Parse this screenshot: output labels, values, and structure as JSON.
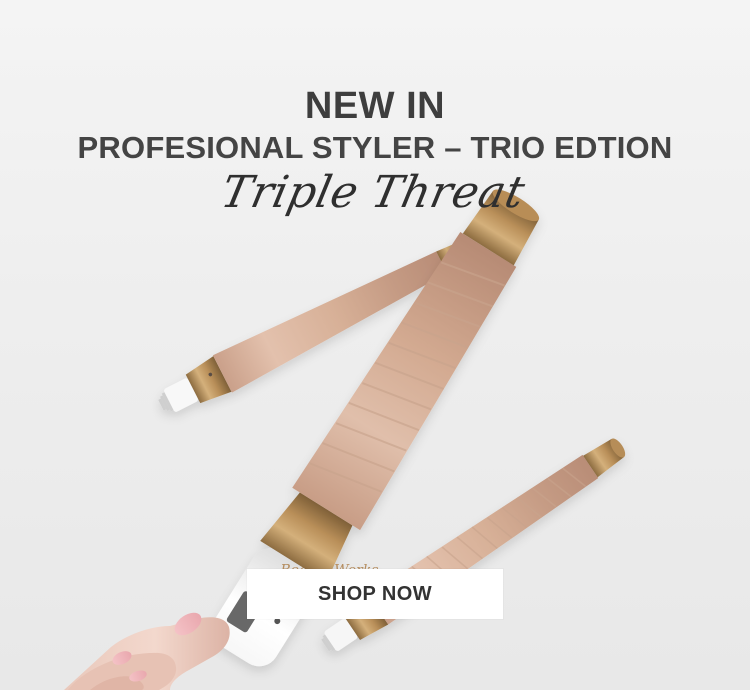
{
  "banner": {
    "kicker": "NEW IN",
    "headline": "PROFESIONAL STYLER – TRIO EDTION",
    "script_title": "Triple Threat",
    "cta_label": "SHOP NOW",
    "brand_name": "Beauty Works"
  },
  "colors": {
    "background": "#eeeeee",
    "text": "#3f3f3f",
    "button_bg": "#ffffff",
    "accent_gold": "#b58d5f",
    "barrel_rose": "#d6af97"
  },
  "icons": [
    "wand-icon",
    "curling-wand-icon",
    "hand-icon"
  ]
}
